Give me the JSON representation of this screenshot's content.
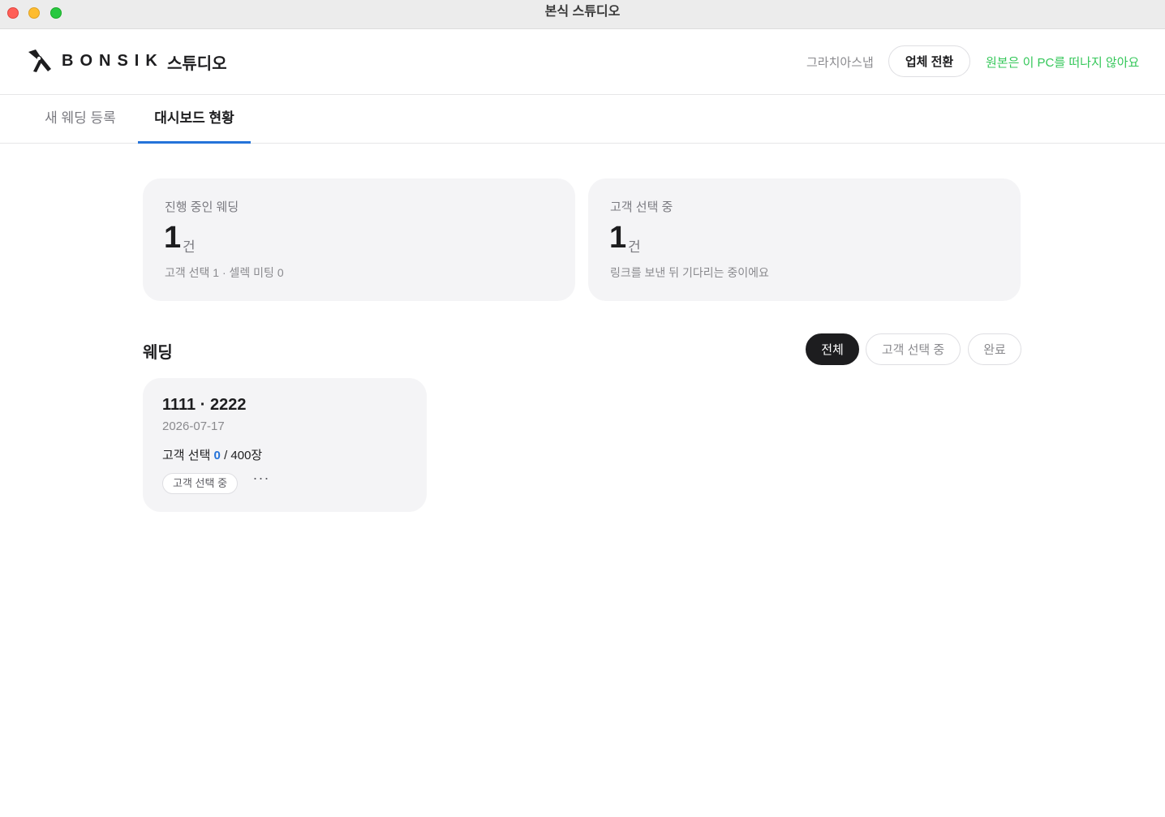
{
  "window": {
    "title": "본식 스튜디오"
  },
  "header": {
    "logo_text": "BONSIK",
    "logo_sub": "스튜디오",
    "studio_name": "그라치아스냅",
    "switch_label": "업체 전환",
    "notice": "원본은 이 PC를 떠나지 않아요",
    "notice_color": "#34c759",
    "logo_icon": "pliers-icon"
  },
  "tabs": [
    {
      "label": "새 웨딩 등록",
      "active": false
    },
    {
      "label": "대시보드 현황",
      "active": true
    }
  ],
  "accent_color": "#2573d9",
  "stats": [
    {
      "label": "진행 중인 웨딩",
      "value": "1",
      "unit": "건",
      "sub": "고객 선택 1 · 셀렉 미팅 0"
    },
    {
      "label": "고객 선택 중",
      "value": "1",
      "unit": "건",
      "sub": "링크를 보낸 뒤 기다리는 중이에요"
    }
  ],
  "weddings_section": {
    "title": "웨딩",
    "filters": [
      {
        "label": "전체",
        "active": true
      },
      {
        "label": "고객 선택 중",
        "active": false
      },
      {
        "label": "완료",
        "active": false
      }
    ]
  },
  "weddings": [
    {
      "title": "1111 · 2222",
      "date": "2026-07-17",
      "count_prefix": "고객 선택",
      "selected": "0",
      "total": "/ 400장",
      "status": "고객 선택 중",
      "more": "···"
    }
  ]
}
